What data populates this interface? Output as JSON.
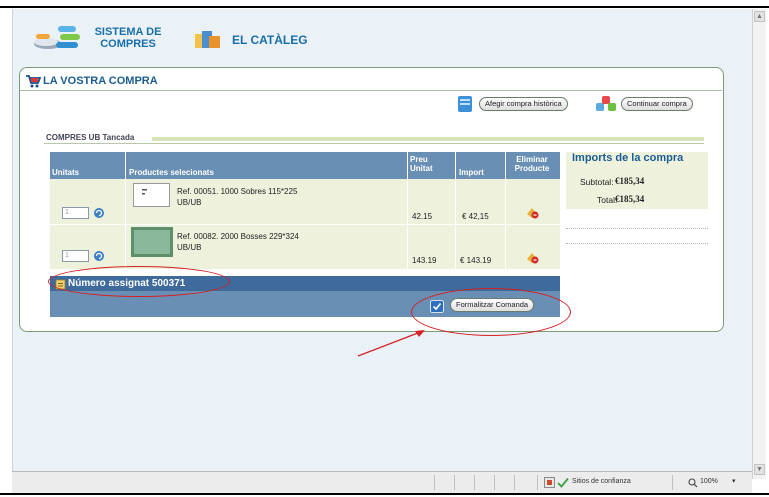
{
  "header": {
    "brand_line1": "SISTEMA DE",
    "brand_line2": "COMPRES",
    "catalog_title": "EL CATÀLEG",
    "logo_icon": "logo-icon",
    "catalog_icon": "catalog-icon"
  },
  "panel": {
    "title": "LA VOSTRA COMPRA",
    "add_history_label": "Afegir compra històrica",
    "continue_label": "Continuar compra"
  },
  "order": {
    "tab_label": "COMPRES UB Tancada",
    "columns": {
      "units": "Unitats",
      "products": "Productes selecionats",
      "price_line1": "Preu",
      "price_line2": "Unitat",
      "amount": "Import",
      "delete_line1": "Eliminar",
      "delete_line2": "Producte"
    },
    "rows": [
      {
        "qty": "1",
        "ref_line1": "Ref. 00051. 1000 Sobres 115*225",
        "ref_line2": "UB/UB",
        "price": "42.15",
        "amount": "€ 42,15"
      },
      {
        "qty": "1",
        "ref_line1": "Ref. 00082. 2000 Bosses 229*324",
        "ref_line2": "UB/UB",
        "price": "143.19",
        "amount": "€ 143.19"
      }
    ],
    "assigned_number": "Número assignat 500371",
    "formalize_label": "Formalitzar Comanda"
  },
  "summary": {
    "title": "Imports de la compra",
    "subtotal_label": "Subtotal:",
    "subtotal_value": "€185,34",
    "total_label": "Total:",
    "total_value": "€185,34"
  },
  "statusbar": {
    "trusted_sites": "Sitios de confianza",
    "zoom": "100%"
  },
  "annotation_color": "#d42020"
}
